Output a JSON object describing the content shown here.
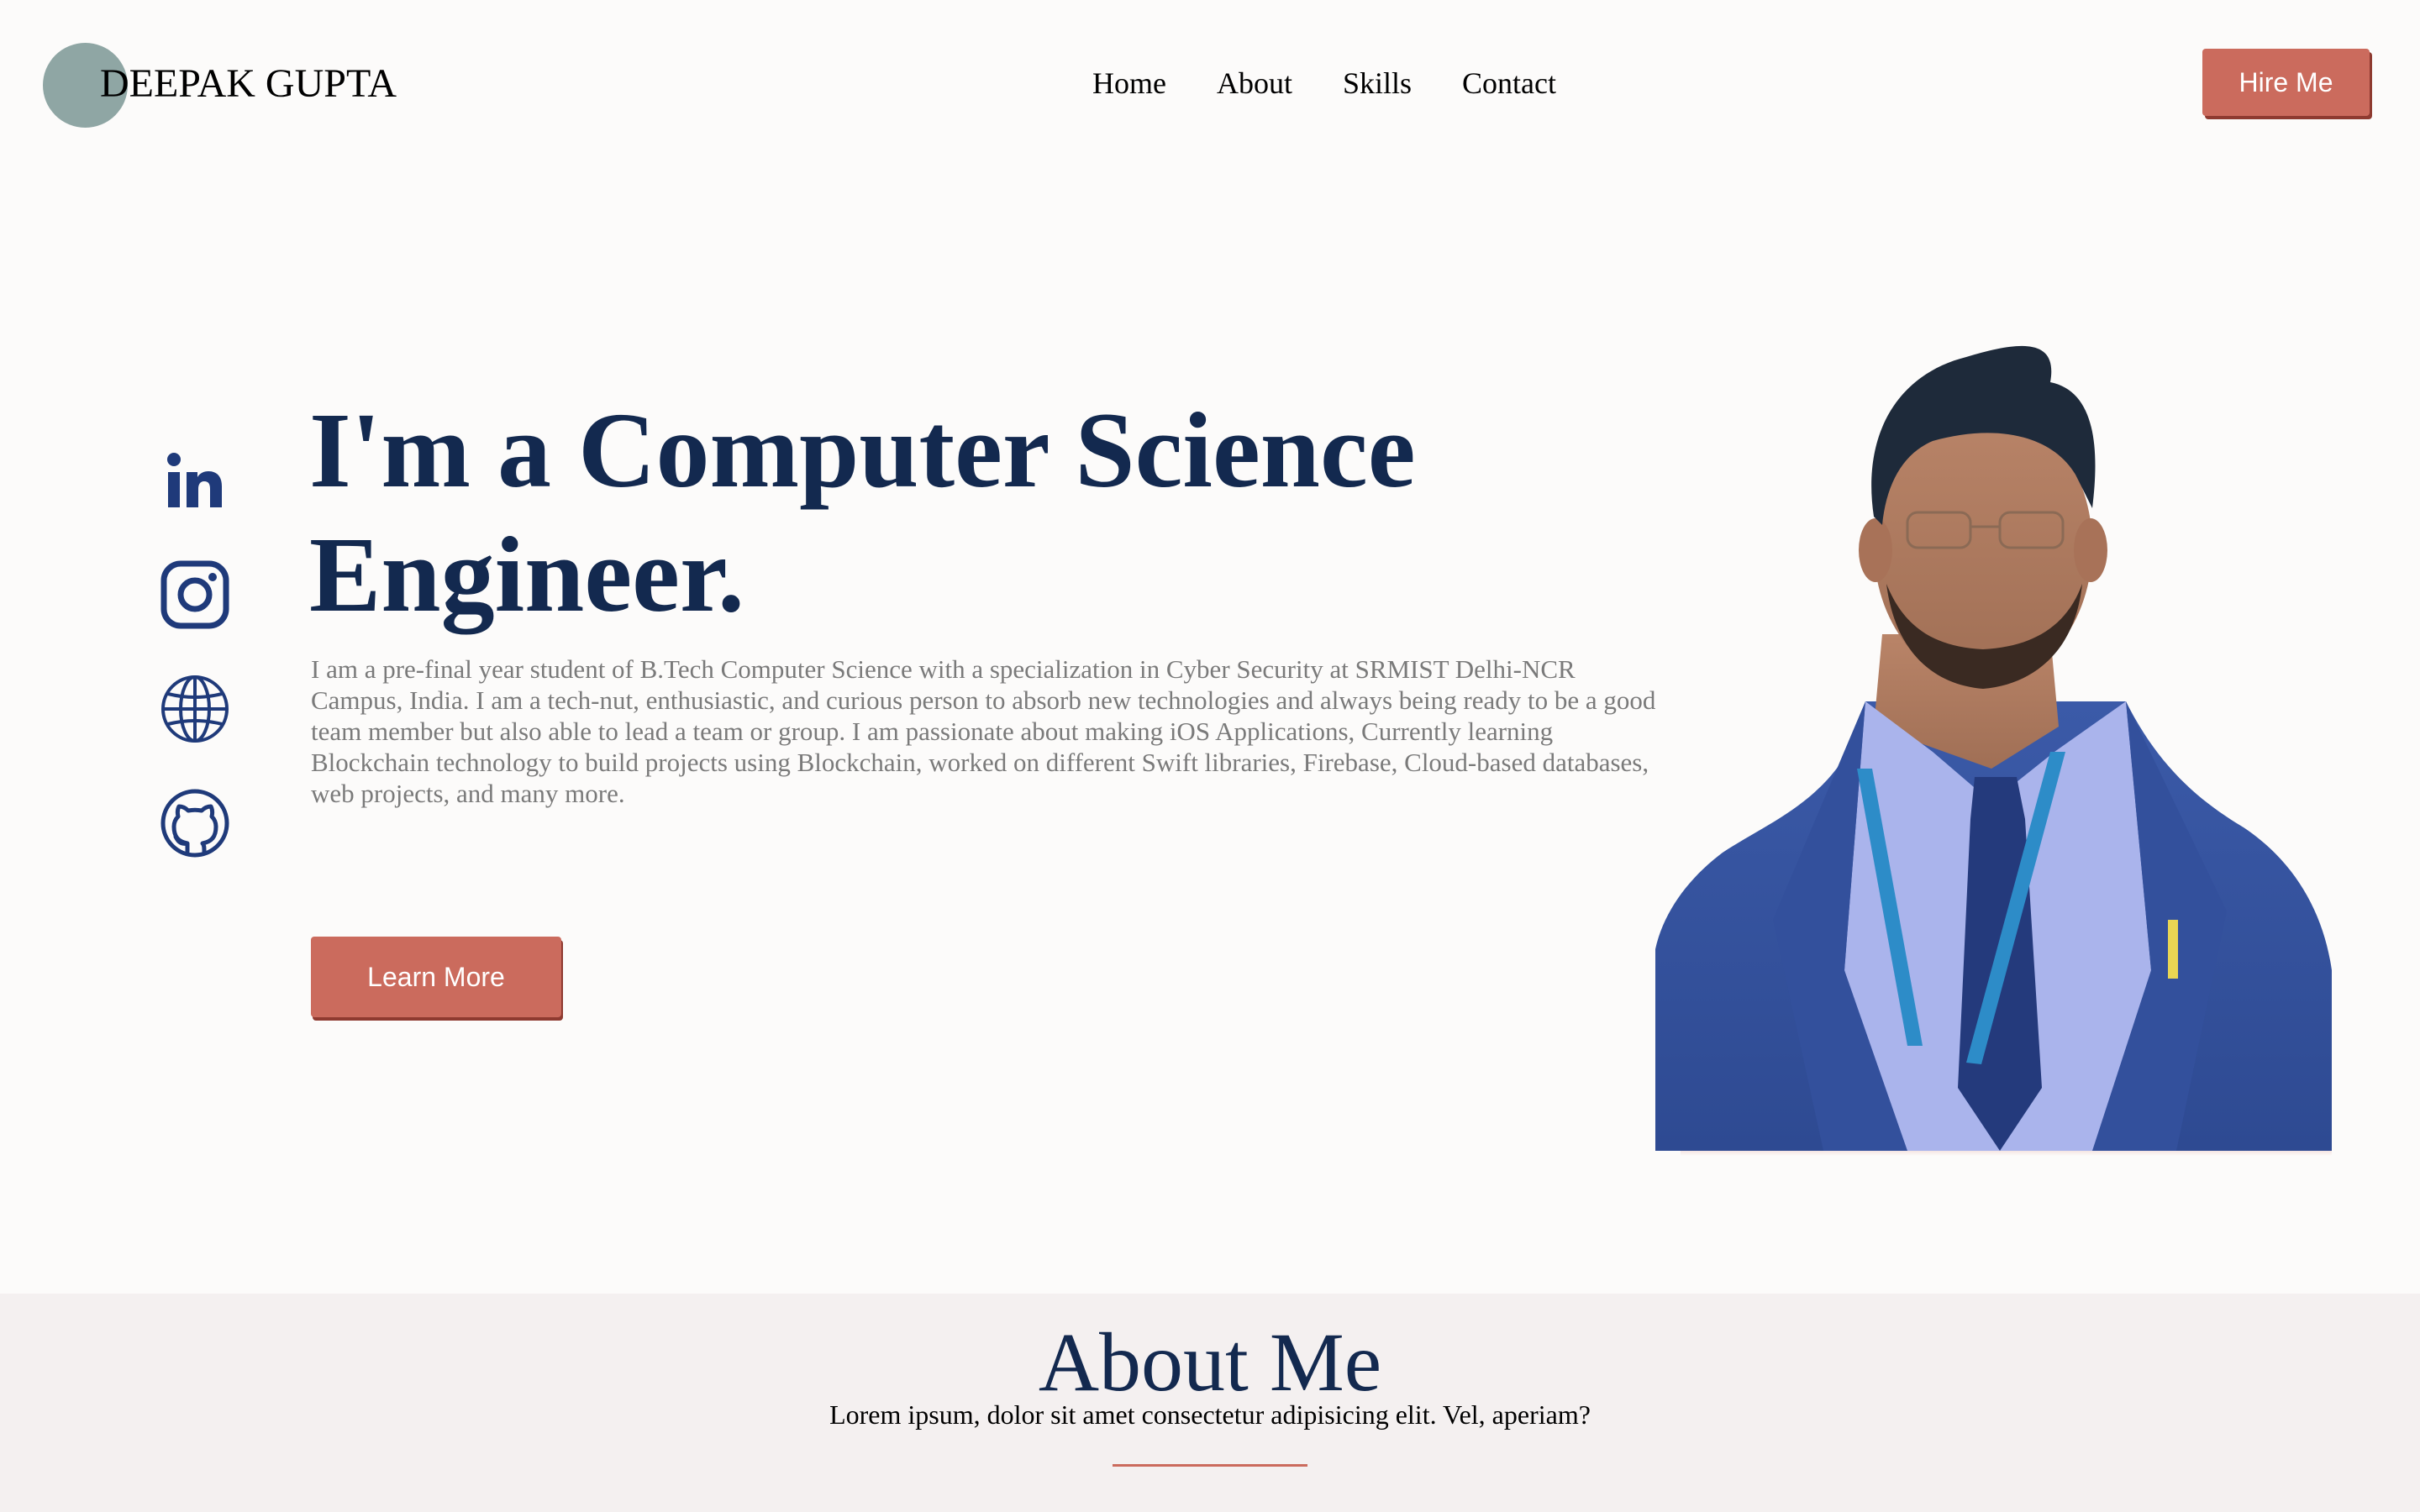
{
  "header": {
    "logo_text": "DEEPAK GUPTA",
    "nav": [
      "Home",
      "About",
      "Skills",
      "Contact"
    ],
    "hire_button": "Hire Me"
  },
  "social": [
    "linkedin-icon",
    "instagram-icon",
    "globe-icon",
    "github-icon"
  ],
  "hero": {
    "title": "I'm a Computer Science Engineer.",
    "description": "I am a pre-final year student of B.Tech Computer Science with a specialization in Cyber Security at SRMIST Delhi-NCR Campus, India. I am a tech-nut, enthusiastic, and curious person to absorb new technologies and always being ready to be a good team member but also able to lead a team or group. I am passionate about making iOS Applications, Currently learning Blockchain technology to build projects using Blockchain, worked on different Swift libraries, Firebase, Cloud-based databases, web projects, and many more.",
    "button": "Learn More"
  },
  "about": {
    "title": "About Me",
    "subtitle": "Lorem ipsum, dolor sit amet consectetur adipisicing elit. Vel, aperiam?"
  },
  "colors": {
    "accent": "#cb6b5d",
    "navy": "#13294f",
    "icon_blue": "#1f3a7a",
    "logo_circle": "#8fa6a4",
    "about_bg": "#f4f0f0"
  }
}
